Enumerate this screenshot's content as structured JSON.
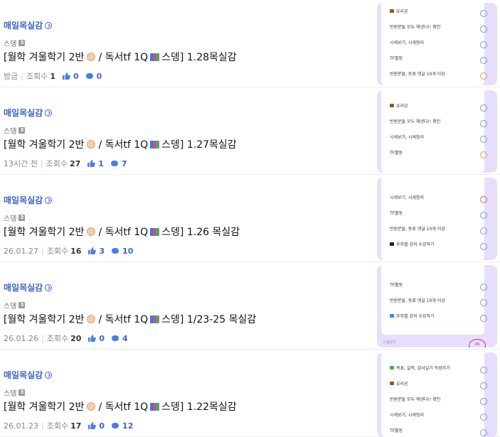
{
  "colors": {
    "board": "#4063c8",
    "accent": "#4a7ee6",
    "thumb_bg": "#e7defc"
  },
  "posts": [
    {
      "board": "매일목실감",
      "author": "스뎅",
      "level": "3",
      "title_pre": "[월학 겨울학기 2반",
      "title_mid": " / 독서tf 1Q",
      "title_post": "스뎅] 1.28목실감",
      "date": "방금",
      "views_label": "조회수",
      "views": "1",
      "likes": "0",
      "comments": "0",
      "thumb_rows": [
        "유리공",
        "반원분들 모두 해낸다!! 확인",
        "시세보기, 시세정리",
        "TF활동",
        "반원분들, 동료 댓글 10개 이상"
      ]
    },
    {
      "board": "매일목실감",
      "author": "스뎅",
      "level": "3",
      "title_pre": "[월학 겨울학기 2반",
      "title_mid": " / 독서tf 1Q",
      "title_post": "스뎅] 1.27목실감",
      "date": "13시간 전",
      "views_label": "조회수",
      "views": "27",
      "likes": "1",
      "comments": "7",
      "thumb_rows": [
        "유리공",
        "반원분들 모두 해낸다!! 확인",
        "시세보기, 시세정리",
        "TF활동"
      ]
    },
    {
      "board": "매일목실감",
      "author": "스뎅",
      "level": "3",
      "title_pre": "[월학 겨울학기 2반",
      "title_mid": " / 독서tf 1Q",
      "title_post": "스뎅] 1.26 목실감",
      "date": "26.01.27",
      "views_label": "조회수",
      "views": "16",
      "likes": "3",
      "comments": "10",
      "thumb_rows": [
        "시세보기, 시세정리",
        "TF활동",
        "반원분들, 동료 댓글 10개 이상",
        "주차별 강의 수강하기"
      ]
    },
    {
      "board": "매일목실감",
      "author": "스뎅",
      "level": "3",
      "title_pre": "[월학 겨울학기 2반",
      "title_mid": " / 독서tf 1Q",
      "title_post": "스뎅] 1/23-25 목실감",
      "date": "26.01.26",
      "views_label": "조회수",
      "views": "20",
      "likes": "0",
      "comments": "4",
      "thumb_rows": [
        "TF활동",
        "반원분들, 동료 댓글 10개 이상",
        "주차별 강의 수강하기"
      ],
      "thumb_footer": "스뎅님의",
      "thumb_circle": "ok"
    },
    {
      "board": "매일목실감",
      "author": "스뎅",
      "level": "3",
      "title_pre": "[월학 겨울학기 2반",
      "title_mid": " / 독서tf 1Q",
      "title_post": "스뎅] 1.22목실감",
      "date": "26.01.23",
      "views_label": "조회수",
      "views": "17",
      "likes": "0",
      "comments": "12",
      "thumb_rows": [
        "목표, 실적, 감사일기 작성하기",
        "유리공",
        "반원분들 모두 해낸다!! 확인",
        "시세보기, 시세정리",
        "TF활동"
      ]
    }
  ]
}
